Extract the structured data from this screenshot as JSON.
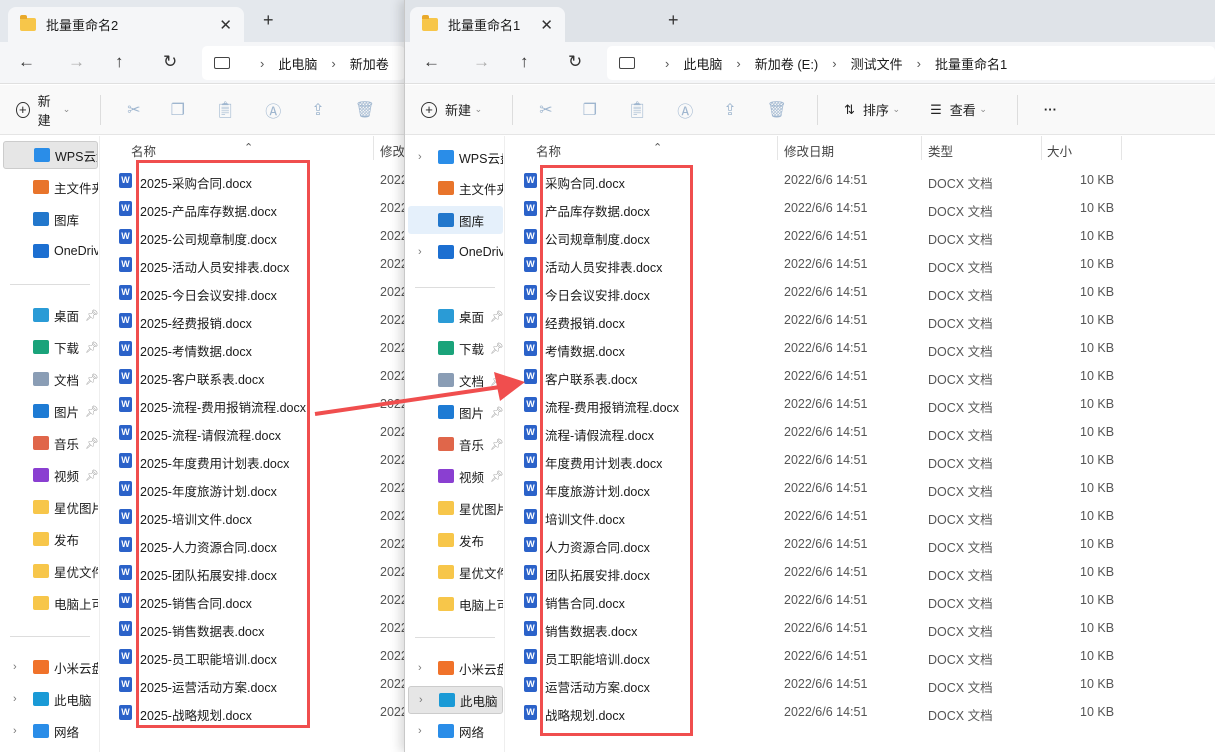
{
  "back_window": {
    "tab_title": "批量重命名2",
    "address": [
      "此电脑",
      "新加卷"
    ],
    "column_name": "名称",
    "column_modified": "修改",
    "date_prefix": "2022",
    "files": [
      "2025-采购合同.docx",
      "2025-产品库存数据.docx",
      "2025-公司规章制度.docx",
      "2025-活动人员安排表.docx",
      "2025-今日会议安排.docx",
      "2025-经费报销.docx",
      "2025-考情数据.docx",
      "2025-客户联系表.docx",
      "2025-流程-费用报销流程.docx",
      "2025-流程-请假流程.docx",
      "2025-年度费用计划表.docx",
      "2025-年度旅游计划.docx",
      "2025-培训文件.docx",
      "2025-人力资源合同.docx",
      "2025-团队拓展安排.docx",
      "2025-销售合同.docx",
      "2025-销售数据表.docx",
      "2025-员工职能培训.docx",
      "2025-运营活动方案.docx",
      "2025-战略规划.docx"
    ]
  },
  "front_window": {
    "tab_title": "批量重命名1",
    "address": [
      "此电脑",
      "新加卷 (E:)",
      "测试文件",
      "批量重命名1"
    ],
    "toolbar": {
      "new": "新建",
      "sort": "排序",
      "view": "查看",
      "more": "···"
    },
    "columns": [
      "名称",
      "修改日期",
      "类型",
      "大小"
    ],
    "files": [
      "采购合同.docx",
      "产品库存数据.docx",
      "公司规章制度.docx",
      "活动人员安排表.docx",
      "今日会议安排.docx",
      "经费报销.docx",
      "考情数据.docx",
      "客户联系表.docx",
      "流程-费用报销流程.docx",
      "流程-请假流程.docx",
      "年度费用计划表.docx",
      "年度旅游计划.docx",
      "培训文件.docx",
      "人力资源合同.docx",
      "团队拓展安排.docx",
      "销售合同.docx",
      "销售数据表.docx",
      "员工职能培训.docx",
      "运营活动方案.docx",
      "战略规划.docx"
    ],
    "modified": "2022/6/6 14:51",
    "type": "DOCX 文档",
    "size": "10 KB"
  },
  "sidebar": [
    {
      "label": "WPS云盘",
      "icon": "cloud-icon",
      "color": "#2a8de8",
      "chev": true
    },
    {
      "label": "主文件夹",
      "icon": "home-icon",
      "color": "#e8742b"
    },
    {
      "label": "图库",
      "icon": "gallery-icon",
      "color": "#2277cc"
    },
    {
      "label": "OneDrive",
      "icon": "onedrive-icon",
      "color": "#1c6fd1",
      "chev": true
    },
    {
      "label": "桌面",
      "icon": "desktop-icon",
      "color": "#2a9bd6",
      "pin": true
    },
    {
      "label": "下载",
      "icon": "download-icon",
      "color": "#1aa37a",
      "pin": true
    },
    {
      "label": "文档",
      "icon": "document-icon",
      "color": "#8a9db5",
      "pin": true
    },
    {
      "label": "图片",
      "icon": "pictures-icon",
      "color": "#1e7bd4",
      "pin": true
    },
    {
      "label": "音乐",
      "icon": "music-icon",
      "color": "#e0664a",
      "pin": true
    },
    {
      "label": "视频",
      "icon": "video-icon",
      "color": "#8a3fd1",
      "pin": true
    },
    {
      "label": "星优图片",
      "icon": "folder-icon",
      "color": "#f7c64a"
    },
    {
      "label": "发布",
      "icon": "folder-icon",
      "color": "#f7c64a"
    },
    {
      "label": "星优文件",
      "icon": "folder-icon",
      "color": "#f7c64a"
    },
    {
      "label": "电脑上可",
      "icon": "folder-icon",
      "color": "#f7c64a"
    },
    {
      "label": "小米云盘",
      "icon": "cloud-icon",
      "color": "#f0722a",
      "chev": true
    },
    {
      "label": "此电脑",
      "icon": "computer-icon",
      "color": "#1a9ad6",
      "chev": true
    },
    {
      "label": "网络",
      "icon": "network-icon",
      "color": "#2a8de8",
      "chev": true
    }
  ],
  "colors": {
    "highlight": "#f04e4e",
    "word": "#2b62c9"
  }
}
